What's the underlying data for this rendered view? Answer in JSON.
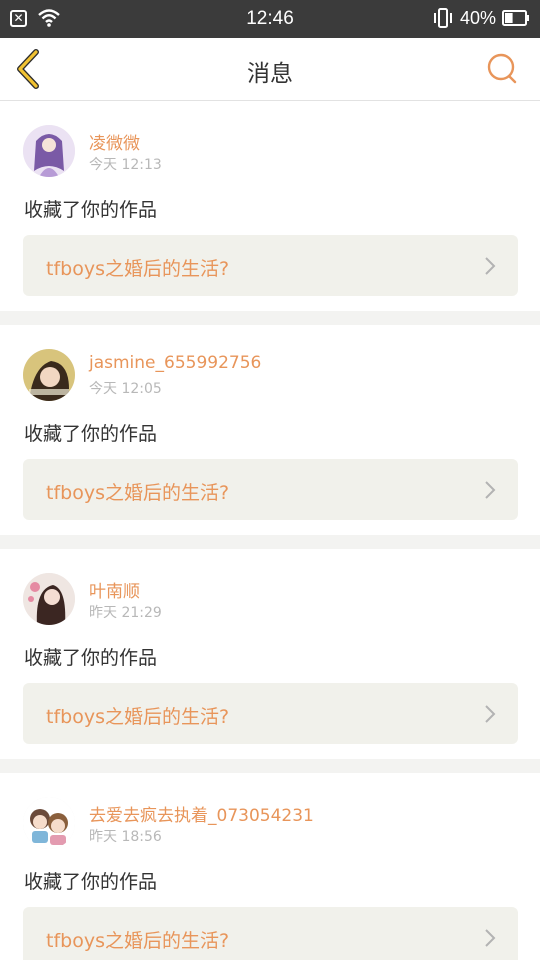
{
  "status_bar": {
    "time": "12:46",
    "battery_percent": "40%",
    "battery_level": 0.4,
    "icons": [
      "notification-x-icon",
      "wifi-icon",
      "vibrate-icon",
      "battery-icon"
    ]
  },
  "header": {
    "title": "消息",
    "back_icon": "chevron-left-icon",
    "search_icon": "search-icon",
    "accent_color": "#e8955a",
    "back_color": "#f1c232"
  },
  "messages": [
    {
      "username": "凌微微",
      "time": "今天 12:13",
      "action": "收藏了你的作品",
      "work_title": "tfboys之婚后的生活?"
    },
    {
      "username": "jasmine_655992756",
      "time": "今天 12:05",
      "action": "收藏了你的作品",
      "work_title": "tfboys之婚后的生活?"
    },
    {
      "username": "叶南顺",
      "time": "昨天 21:29",
      "action": "收藏了你的作品",
      "work_title": "tfboys之婚后的生活?"
    },
    {
      "username": "去爱去疯去执着_073054231",
      "time": "昨天 18:56",
      "action": "收藏了你的作品",
      "work_title": "tfboys之婚后的生活?"
    }
  ]
}
